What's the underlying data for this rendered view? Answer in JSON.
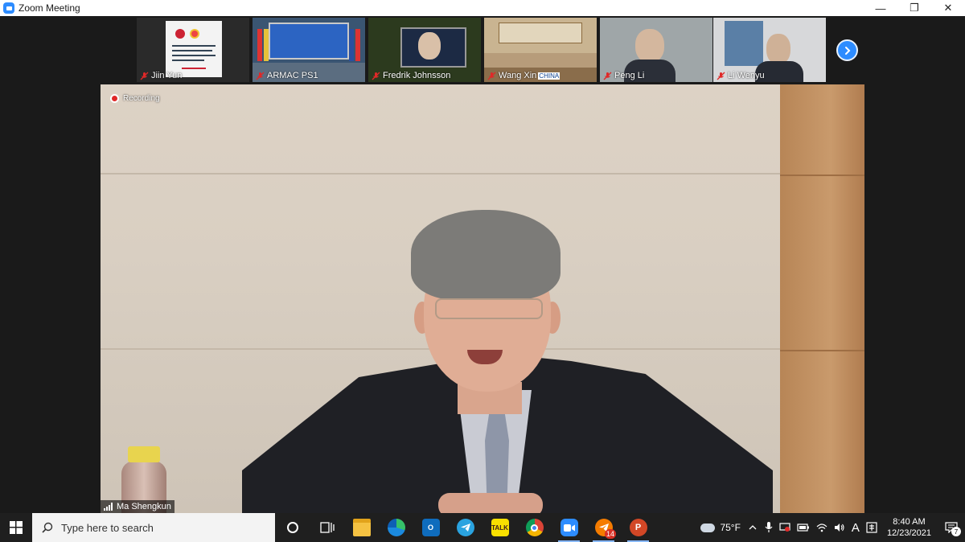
{
  "window": {
    "title": "Zoom Meeting",
    "controls": {
      "minimize": "—",
      "restore": "❐",
      "close": "✕"
    }
  },
  "gallery": {
    "participants": [
      {
        "name": "Jiin Yun",
        "muted": true
      },
      {
        "name": "ARMAC PS1",
        "muted": true
      },
      {
        "name": "Fredrik Johnsson",
        "muted": true
      },
      {
        "name": "Wang Xin",
        "muted": true,
        "overlay_text": "CHINA"
      },
      {
        "name": "Peng Li",
        "muted": true
      },
      {
        "name": "Li Wenyu",
        "muted": true
      }
    ],
    "next_icon": "chevron-right-icon"
  },
  "active_speaker": {
    "name": "Ma Shengkun",
    "recording_label": "Recording"
  },
  "taskbar": {
    "search_placeholder": "Type here to search",
    "apps": [
      {
        "icon": "cortana-icon",
        "active": false
      },
      {
        "icon": "task-view-icon",
        "active": false
      },
      {
        "icon": "file-explorer-icon",
        "active": false
      },
      {
        "icon": "edge-icon",
        "active": false
      },
      {
        "icon": "outlook-icon",
        "active": false
      },
      {
        "icon": "telegram-icon",
        "active": false
      },
      {
        "icon": "kakaotalk-icon",
        "active": false,
        "label": "TALK"
      },
      {
        "icon": "chrome-icon",
        "active": false
      },
      {
        "icon": "zoom-icon",
        "active": true
      },
      {
        "icon": "mail-app-icon",
        "active": true,
        "badge": "14"
      },
      {
        "icon": "powerpoint-icon",
        "active": true,
        "label": "P"
      }
    ],
    "weather": "75°F",
    "input_indicator": "A",
    "time": "8:40 AM",
    "date": "12/23/2021",
    "notifications_count": "7",
    "colors": {
      "zoom_blue": "#2d8cff",
      "recording_red": "#e02828",
      "taskbar_bg": "#1f1f1f"
    }
  }
}
